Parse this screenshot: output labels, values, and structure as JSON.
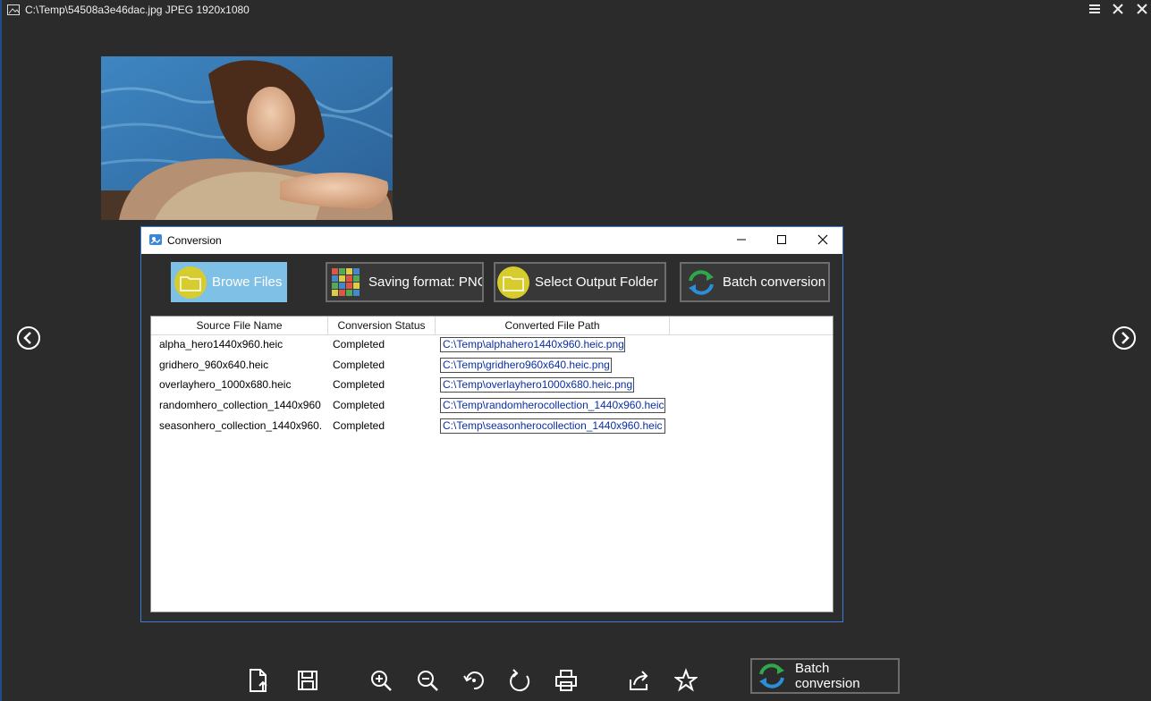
{
  "window": {
    "title": "C:\\Temp\\54508a3e46dac.jpg JPEG 1920x1080"
  },
  "dialog": {
    "title": "Conversion",
    "buttons": {
      "browse": "Browe Files",
      "format": "Saving format: PNG",
      "output": "Select Output Folder",
      "batch": "Batch conversion"
    },
    "table": {
      "columns": [
        "Source File Name",
        "Conversion Status",
        "Converted File Path"
      ],
      "rows": [
        {
          "source": "alpha_hero1440x960.heic",
          "status": "Completed",
          "path": "C:\\Temp\\alphahero1440x960.heic.png"
        },
        {
          "source": "gridhero_960x640.heic",
          "status": "Completed",
          "path": "C:\\Temp\\gridhero960x640.heic.png"
        },
        {
          "source": "overlayhero_1000x680.heic",
          "status": "Completed",
          "path": "C:\\Temp\\overlayhero1000x680.heic.png"
        },
        {
          "source": "randomhero_collection_1440x960",
          "status": "Completed",
          "path": "C:\\Temp\\randomherocollection_1440x960.heic"
        },
        {
          "source": "seasonhero_collection_1440x960.",
          "status": "Completed",
          "path": "C:\\Temp\\seasonherocollection_1440x960.heic"
        }
      ]
    }
  },
  "bottom_toolbar": {
    "batch_label": "Batch conversion",
    "icons": [
      "open-file-icon",
      "save-icon",
      "zoom-in-icon",
      "zoom-out-icon",
      "rotate-left-icon",
      "rotate-right-icon",
      "print-icon",
      "share-icon",
      "favorite-icon"
    ]
  },
  "colors": {
    "accent": "#3a7bd5",
    "folder": "#d7cc2d",
    "browse_active": "#7fc0e6",
    "link": "#0b2fa6"
  }
}
